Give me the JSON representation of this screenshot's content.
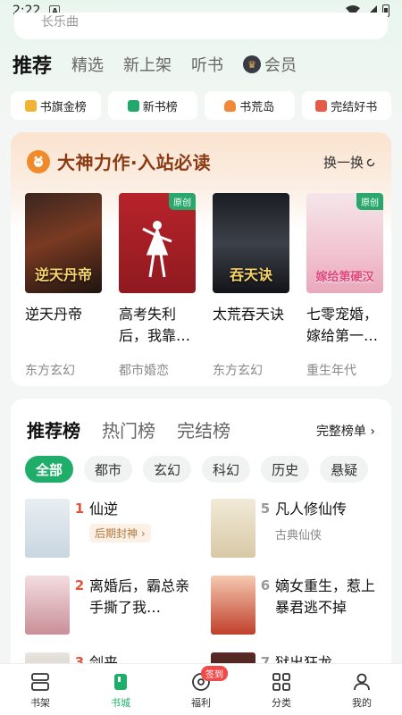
{
  "status_bar": {
    "time": "2:22",
    "notification": "A"
  },
  "search": {
    "placeholder": "长乐曲"
  },
  "top_tabs": [
    {
      "label": "推荐"
    },
    {
      "label": "精选"
    },
    {
      "label": "新上架"
    },
    {
      "label": "听书"
    },
    {
      "label": "会员"
    }
  ],
  "quick_links": [
    {
      "label": "书旗金榜",
      "color": "#f2b233"
    },
    {
      "label": "新书榜",
      "color": "#21a86a"
    },
    {
      "label": "书荒岛",
      "color": "#f08a3a"
    },
    {
      "label": "完结好书",
      "color": "#e65a4a"
    }
  ],
  "promo": {
    "title": "大神力作·入站必读",
    "refresh_label": "换一换",
    "books": [
      {
        "name": "逆天丹帝",
        "genre": "东方玄幻",
        "cover_text": "逆天丹帝",
        "badge": ""
      },
      {
        "name": "高考失利后，我靠…",
        "genre": "都市婚恋",
        "cover_text": "",
        "badge": "原创"
      },
      {
        "name": "太荒吞天诀",
        "genre": "东方玄幻",
        "cover_text": "吞天诀",
        "badge": ""
      },
      {
        "name": "七零宠婚，嫁给第一…",
        "genre": "重生年代",
        "cover_text": "嫁给第硬汉",
        "badge": "原创"
      }
    ]
  },
  "rank": {
    "tabs": [
      {
        "label": "推荐榜"
      },
      {
        "label": "热门榜"
      },
      {
        "label": "完结榜"
      }
    ],
    "full_label": "完整榜单 ›",
    "chips": [
      "全部",
      "都市",
      "玄幻",
      "科幻",
      "历史",
      "悬疑"
    ],
    "items": [
      {
        "num": "1",
        "title": "仙逆",
        "tag": "后期封神 ›",
        "sub": ""
      },
      {
        "num": "5",
        "title": "凡人修仙传",
        "tag": "",
        "sub": "古典仙侠"
      },
      {
        "num": "2",
        "title": "离婚后，霸总亲手撕了我…",
        "tag": "",
        "sub": ""
      },
      {
        "num": "6",
        "title": "嫡女重生，惹上暴君逃不掉",
        "tag": "",
        "sub": ""
      },
      {
        "num": "3",
        "title": "剑来",
        "tag": "",
        "sub": ""
      },
      {
        "num": "7",
        "title": "狱出狂龙",
        "tag": "",
        "sub": ""
      }
    ]
  },
  "bottom_nav": [
    {
      "label": "书架"
    },
    {
      "label": "书城"
    },
    {
      "label": "福利"
    },
    {
      "label": "分类"
    },
    {
      "label": "我的"
    }
  ],
  "sign_badge": "签到"
}
